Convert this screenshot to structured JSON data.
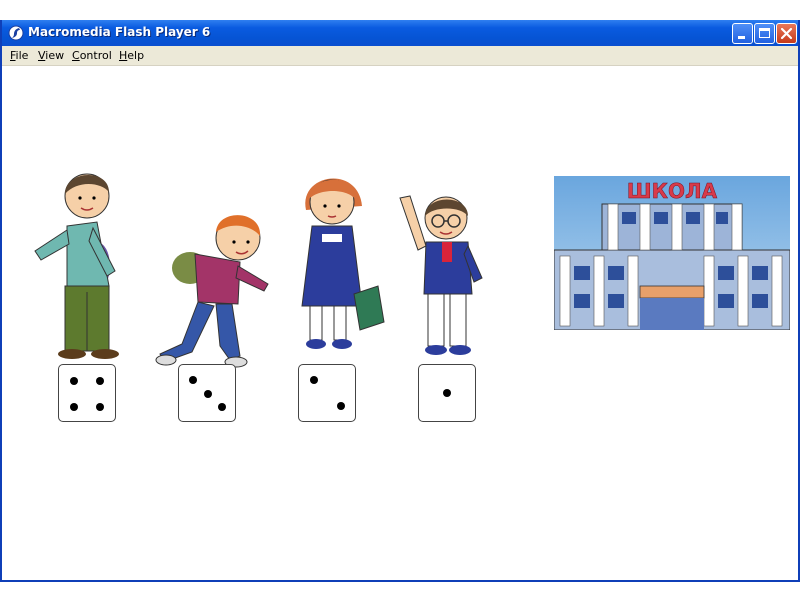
{
  "window": {
    "title": "Macromedia Flash Player 6",
    "icon": "flash-icon",
    "caption_buttons": [
      "minimize-icon",
      "maximize-icon",
      "close-icon"
    ]
  },
  "menu": [
    {
      "label": "File",
      "underline": "F",
      "rest": "ile"
    },
    {
      "label": "View",
      "underline": "V",
      "rest": "iew"
    },
    {
      "label": "Control",
      "underline": "C",
      "rest": "ontrol"
    },
    {
      "label": "Help",
      "underline": "H",
      "rest": "elp"
    }
  ],
  "scene": {
    "children": [
      {
        "name": "boy-pointing",
        "die_value": 4
      },
      {
        "name": "boy-running",
        "die_value": 3
      },
      {
        "name": "girl-with-bag",
        "die_value": 2
      },
      {
        "name": "boy-glasses",
        "die_value": 1
      }
    ],
    "school_sign": "ШКОЛА"
  },
  "colors": {
    "titlebar": "#0a5be0",
    "menubar": "#ece9d8",
    "close_button": "#c63a1a"
  }
}
